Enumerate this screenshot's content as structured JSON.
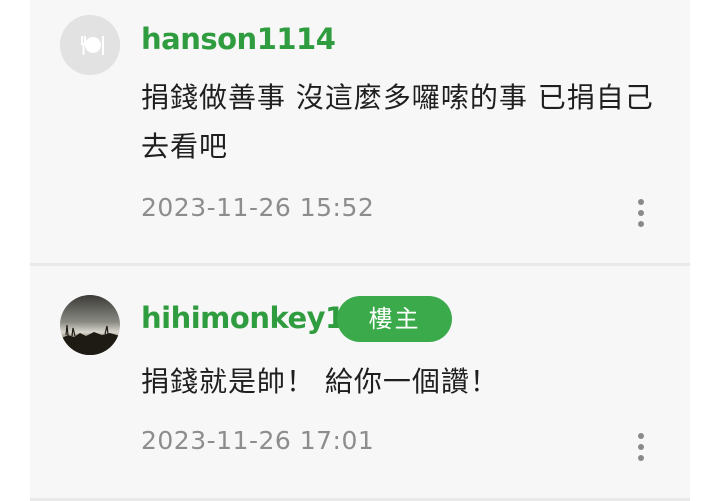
{
  "comments": [
    {
      "username": "hanson1114",
      "text": "捐錢做善事 沒這麼多囉嗦的事 已捐自己去看吧",
      "timestamp": "2023-11-26 15:52",
      "avatar": "default-avatar-icon"
    },
    {
      "username": "hihimonkey1",
      "badge": "樓主",
      "text": "捐錢就是帥！ 給你一個讚！",
      "timestamp": "2023-11-26 17:01",
      "avatar": "user-photo-avatar"
    }
  ],
  "colors": {
    "username": "#2f9d3f",
    "badge_bg": "#3aaa4a",
    "timestamp": "#8d8d8d",
    "background": "#f7f7f7"
  },
  "icons": {
    "more": "more-vertical-icon"
  }
}
